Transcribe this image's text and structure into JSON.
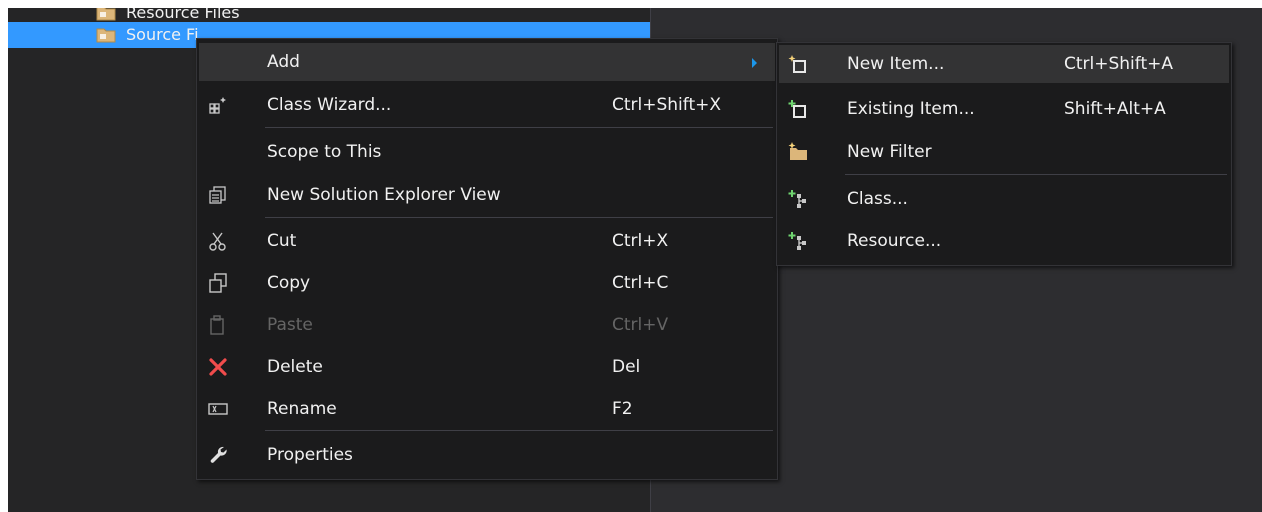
{
  "solution_explorer": {
    "items": [
      {
        "label": "Resource Files",
        "icon": "filter-folder-icon"
      },
      {
        "label": "Source Fi",
        "icon": "filter-folder-icon",
        "selected": true
      }
    ]
  },
  "context_menu": {
    "items": [
      {
        "label": "Add",
        "shortcut": "",
        "icon": "",
        "submenu": true
      },
      {
        "label": "Class Wizard...",
        "shortcut": "Ctrl+Shift+X",
        "icon": "class-wizard-icon"
      },
      {
        "label": "Scope to This",
        "shortcut": "",
        "icon": ""
      },
      {
        "label": "New Solution Explorer View",
        "shortcut": "",
        "icon": "new-view-icon"
      },
      {
        "label": "Cut",
        "shortcut": "Ctrl+X",
        "icon": "scissors-icon"
      },
      {
        "label": "Copy",
        "shortcut": "Ctrl+C",
        "icon": "copy-icon"
      },
      {
        "label": "Paste",
        "shortcut": "Ctrl+V",
        "icon": "clipboard-icon",
        "disabled": true
      },
      {
        "label": "Delete",
        "shortcut": "Del",
        "icon": "delete-x-icon"
      },
      {
        "label": "Rename",
        "shortcut": "F2",
        "icon": "rename-icon"
      },
      {
        "label": "Properties",
        "shortcut": "",
        "icon": "wrench-icon"
      }
    ]
  },
  "add_submenu": {
    "items": [
      {
        "label": "New Item...",
        "shortcut": "Ctrl+Shift+A",
        "icon": "new-item-icon"
      },
      {
        "label": "Existing Item...",
        "shortcut": "Shift+Alt+A",
        "icon": "existing-item-icon"
      },
      {
        "label": "New Filter",
        "shortcut": "",
        "icon": "new-filter-icon"
      },
      {
        "label": "Class...",
        "shortcut": "",
        "icon": "add-class-icon"
      },
      {
        "label": "Resource...",
        "shortcut": "",
        "icon": "add-resource-icon"
      }
    ]
  },
  "colors": {
    "menu_bg": "#1b1b1c",
    "selection": "#3399ff",
    "submenu_arrow": "#1c97ea",
    "delete_red": "#e51400",
    "add_green": "#6fd36f"
  }
}
